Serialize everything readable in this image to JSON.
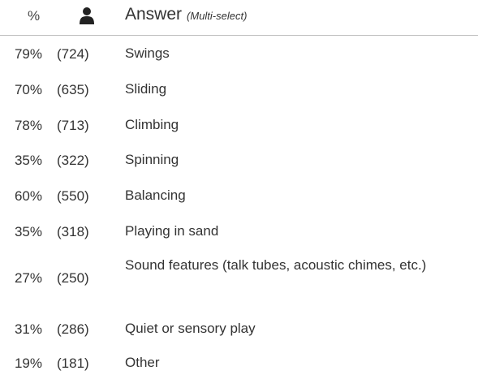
{
  "header": {
    "percent_label": "%",
    "respondents_icon": "person-icon",
    "answer_label": "Answer",
    "answer_note": "(Multi-select)"
  },
  "results": [
    {
      "percent": "79%",
      "count": "(724)",
      "answer": "Swings"
    },
    {
      "percent": "70%",
      "count": "(635)",
      "answer": "Sliding"
    },
    {
      "percent": "78%",
      "count": "(713)",
      "answer": "Climbing"
    },
    {
      "percent": "35%",
      "count": "(322)",
      "answer": "Spinning"
    },
    {
      "percent": "60%",
      "count": "(550)",
      "answer": "Balancing"
    },
    {
      "percent": "35%",
      "count": "(318)",
      "answer": "Playing in sand"
    },
    {
      "percent": "27%",
      "count": "(250)",
      "answer": "Sound features (talk tubes, acoustic chimes, etc.)"
    },
    {
      "percent": "31%",
      "count": "(286)",
      "answer": "Quiet or sensory play"
    },
    {
      "percent": "19%",
      "count": "(181)",
      "answer": "Other"
    }
  ],
  "colors": {
    "text": "#333333",
    "divider": "#bdbdbd"
  }
}
